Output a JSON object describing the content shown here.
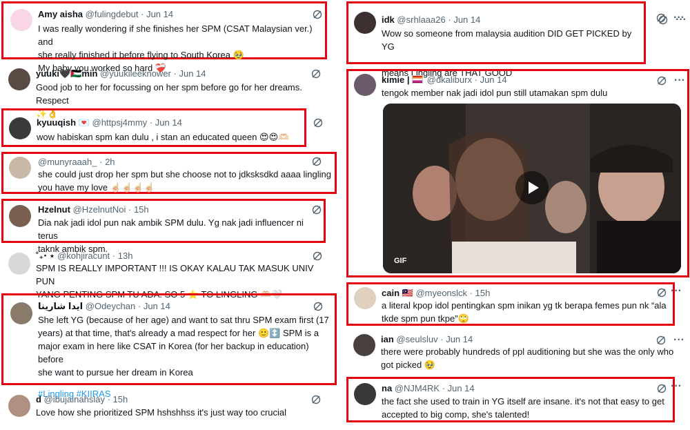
{
  "colors": {
    "highlight": "#e3000f",
    "link": "#1d9bf0",
    "muted": "#536471"
  },
  "tweets": [
    {
      "name": "Amy aisha",
      "handle": "@fulingdebut",
      "time": "Jun 14",
      "lines": [
        "I was really wondering if she finishes her SPM (CSAT Malaysian ver.) and",
        "she really finished it before flying to South Korea 🥹",
        "My baby you worked so hard ❤️‍🩹"
      ]
    },
    {
      "name": "yuuki🖤🇵🇸min",
      "handle": "@yuukileeknower",
      "time": "Jun 14",
      "lines": [
        "Good job to her for focussing on her spm before go for her dreams. Respect",
        "✨👌"
      ]
    },
    {
      "name": "kyuuqish 💌",
      "handle": "@httpsj4mmy",
      "time": "Jun 14",
      "lines": [
        "wow habiskan spm kan dulu , i stan an educated queen 😍😍🫶🏻"
      ]
    },
    {
      "name": "",
      "handle": "@munyraaah_",
      "time": "2h",
      "lines": [
        "she could just drop her spm but she choose not to jdksksdkd aaaa lingling",
        "you have my love ☝🏻☝🏻☝🏻☝🏻"
      ]
    },
    {
      "name": "Hzelnut",
      "handle": "@HzelnutNoi",
      "time": "15h",
      "lines": [
        "Dia nak jadi idol pun nak ambik SPM dulu. Yg nak jadi influencer ni terus",
        "taknk ambik spm."
      ]
    },
    {
      "name": "˚₊‧ ⋆",
      "handle": "@kohjiracunt",
      "time": "13h",
      "lines": [
        "SPM IS REALLY IMPORTANT !!! IS OKAY KALAU TAK MASUK UNIV PUN",
        "YANG PENTING SPM TU ADA. SO 5 ⭐ TO LINGLING 🫶🏻🤍"
      ]
    },
    {
      "name": "ايدا شارينا",
      "handle": "@Odeychan",
      "time": "Jun 14",
      "lines": [
        "She left YG (because of her age) and want to sat thru SPM exam first (17",
        "years) at that time, that's already a mad respect for her 🙂↕️ SPM is a",
        "major exam in here like CSAT in Korea (for her backup in education) before",
        "she want to pursue her dream in Korea"
      ],
      "hashtags": "#Lingling #KIIRAS"
    },
    {
      "name": "d",
      "handle": "@ibujainahslay",
      "time": "15h",
      "lines": [
        "Love how she prioritized SPM hshshhss it's just way too crucial"
      ]
    },
    {
      "name": "idk",
      "handle": "@srhlaaa26",
      "time": "Jun 14",
      "lines": [
        "Wow so someone from malaysia audition DID GET PICKED by YG",
        "",
        "means Lingling are THAT GOOD"
      ]
    },
    {
      "name": "kimie |",
      "handle": "@dkaliburx",
      "time": "Jun 14",
      "lines": [
        "tengok member nak jadi idol pun still utamakan spm dulu"
      ],
      "media_badge": "GIF"
    },
    {
      "name": "cain 🇲🇾",
      "handle": "@myeonslck",
      "time": "15h",
      "lines": [
        "a literal kpop idol pentingkan spm inikan yg tk berapa femes pun nk “ala",
        "tkde spm pun tkpe”🙄"
      ]
    },
    {
      "name": "ian",
      "handle": "@seulsluv",
      "time": "Jun 14",
      "lines": [
        "there were probably hundreds of ppl auditioning but she was the only who",
        "got picked 🥹"
      ]
    },
    {
      "name": "na",
      "handle": "@NJM4RK",
      "time": "Jun 14",
      "lines": [
        "the fact she used to train in YG itself are insane. it's not that easy to get",
        "accepted to big comp, she's talented!"
      ]
    }
  ]
}
